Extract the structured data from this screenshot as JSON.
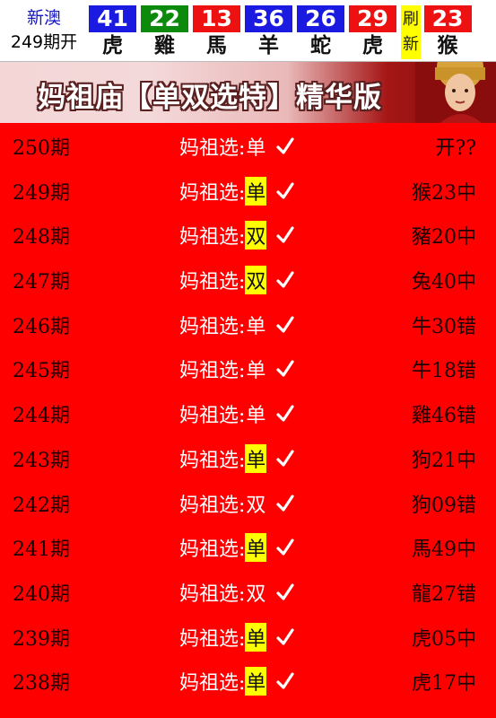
{
  "topbar": {
    "region": "新澳",
    "issue": "249期开",
    "balls": [
      {
        "num": "41",
        "zodiac": "虎",
        "color": "blue"
      },
      {
        "num": "22",
        "zodiac": "雞",
        "color": "green"
      },
      {
        "num": "13",
        "zodiac": "馬",
        "color": "red"
      },
      {
        "num": "36",
        "zodiac": "羊",
        "color": "blue"
      },
      {
        "num": "26",
        "zodiac": "蛇",
        "color": "blue"
      },
      {
        "num": "29",
        "zodiac": "虎",
        "color": "red"
      }
    ],
    "refresh_top": "刷",
    "refresh_bottom": "新",
    "special": {
      "num": "23",
      "zodiac": "猴",
      "color": "red"
    }
  },
  "banner": {
    "title": "妈祖庙【单双选特】精华版"
  },
  "colors": {
    "background": "#ff0000",
    "highlight": "#ffff00",
    "ball_blue": "#1a1ae0",
    "ball_green": "#0b8a0b",
    "ball_red": "#ee1111"
  },
  "rows": [
    {
      "period": "250期",
      "label": "妈祖选:",
      "value": "单",
      "highlight": false,
      "result": "开??"
    },
    {
      "period": "249期",
      "label": "妈祖选:",
      "value": "单",
      "highlight": true,
      "result": "猴23中"
    },
    {
      "period": "248期",
      "label": "妈祖选:",
      "value": "双",
      "highlight": true,
      "result": "豬20中"
    },
    {
      "period": "247期",
      "label": "妈祖选:",
      "value": "双",
      "highlight": true,
      "result": "兔40中"
    },
    {
      "period": "246期",
      "label": "妈祖选:",
      "value": "单",
      "highlight": false,
      "result": "牛30错"
    },
    {
      "period": "245期",
      "label": "妈祖选:",
      "value": "单",
      "highlight": false,
      "result": "牛18错"
    },
    {
      "period": "244期",
      "label": "妈祖选:",
      "value": "单",
      "highlight": false,
      "result": "雞46错"
    },
    {
      "period": "243期",
      "label": "妈祖选:",
      "value": "单",
      "highlight": true,
      "result": "狗21中"
    },
    {
      "period": "242期",
      "label": "妈祖选:",
      "value": "双",
      "highlight": false,
      "result": "狗09错"
    },
    {
      "period": "241期",
      "label": "妈祖选:",
      "value": "单",
      "highlight": true,
      "result": "馬49中"
    },
    {
      "period": "240期",
      "label": "妈祖选:",
      "value": "双",
      "highlight": false,
      "result": "龍27错"
    },
    {
      "period": "239期",
      "label": "妈祖选:",
      "value": "单",
      "highlight": true,
      "result": "虎05中"
    },
    {
      "period": "238期",
      "label": "妈祖选:",
      "value": "单",
      "highlight": true,
      "result": "虎17中"
    }
  ]
}
